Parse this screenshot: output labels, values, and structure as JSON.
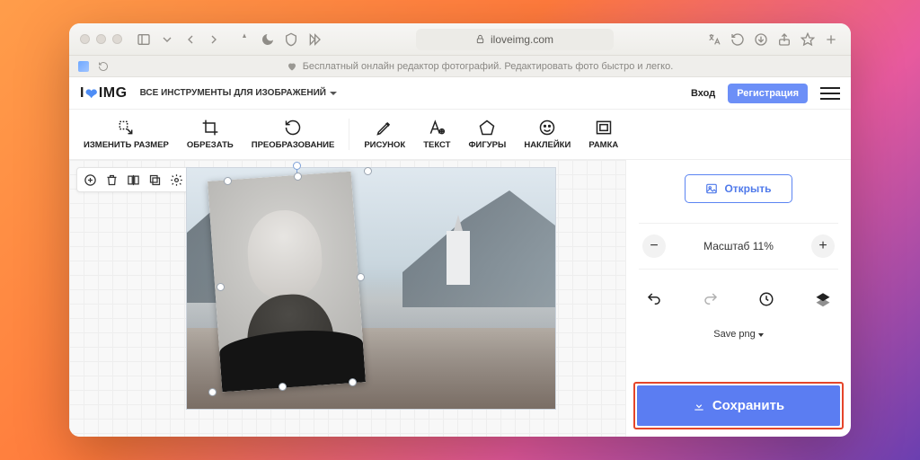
{
  "browser": {
    "address": "iloveimg.com"
  },
  "tab": {
    "title": "Бесплатный онлайн редактор фотографий. Редактировать фото быстро и легко."
  },
  "header": {
    "logo_prefix": "I",
    "logo_mid_heart": "❤",
    "logo_suffix": "IMG",
    "tools_dropdown": "ВСЕ ИНСТРУМЕНТЫ ДЛЯ ИЗОБРАЖЕНИЙ",
    "login": "Вход",
    "signup": "Регистрация"
  },
  "toolbar": {
    "items_left": [
      {
        "label": "ИЗМЕНИТЬ РАЗМЕР",
        "icon": "resize"
      },
      {
        "label": "ОБРЕЗАТЬ",
        "icon": "crop"
      },
      {
        "label": "ПРЕОБРАЗОВАНИЕ",
        "icon": "rotate"
      }
    ],
    "items_right": [
      {
        "label": "РИСУНОК",
        "icon": "pencil"
      },
      {
        "label": "ТЕКСТ",
        "icon": "text"
      },
      {
        "label": "ФИГУРЫ",
        "icon": "shape"
      },
      {
        "label": "НАКЛЕЙКИ",
        "icon": "sticker"
      },
      {
        "label": "РАМКА",
        "icon": "frame"
      }
    ]
  },
  "side": {
    "open": "Открыть",
    "zoom_label": "Масштаб  11%",
    "minus": "−",
    "plus": "+",
    "save_format": "Save png",
    "save": "Сохранить"
  }
}
